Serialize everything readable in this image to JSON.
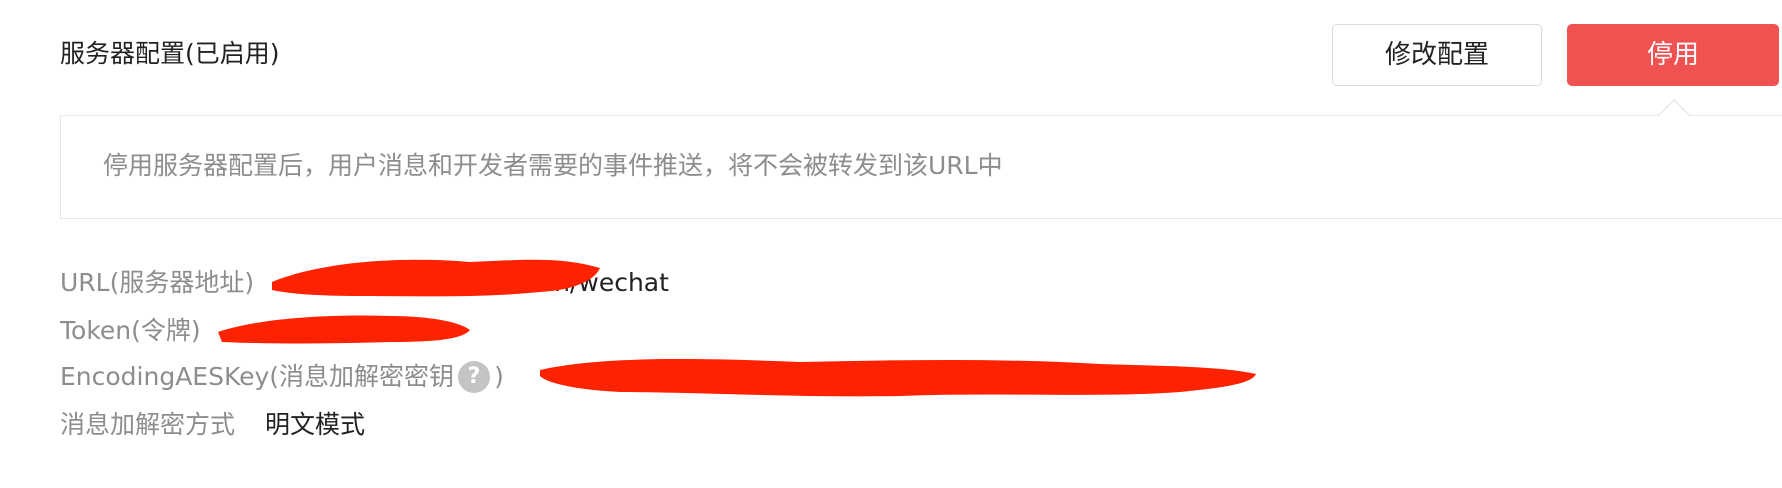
{
  "header": {
    "section_title": "服务器配置(已启用)",
    "edit_label": "修改配置",
    "disable_label": "停用"
  },
  "tip": {
    "text": "停用服务器配置后，用户消息和开发者需要的事件推送，将不会被转发到该URL中"
  },
  "fields": {
    "url_label": "URL(服务器地址)",
    "url_value": "n/wechat",
    "token_label": "Token(令牌)",
    "aes_label": "EncodingAESKey(消息加解密密钥",
    "aes_label_close": ")",
    "help_icon_glyph": "?",
    "mode_label": "消息加解密方式",
    "mode_value": "明文模式"
  },
  "colors": {
    "primary_danger": "#f05252",
    "redaction": "#ff2200",
    "label_gray": "#8d8d8d",
    "text_dark": "#222222"
  }
}
